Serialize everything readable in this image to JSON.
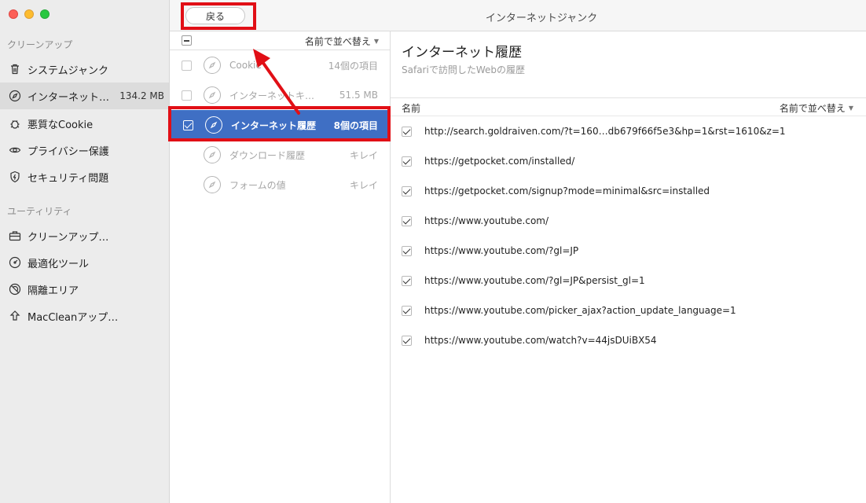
{
  "window": {
    "title": "インターネットジャンク"
  },
  "toolbar": {
    "back_label": "戻る"
  },
  "sidebar": {
    "sections": [
      {
        "title": "クリーンアップ"
      },
      {
        "title": "ユーティリティ"
      }
    ],
    "cleanup_items": [
      {
        "label": "システムジャンク",
        "icon": "trash-icon"
      },
      {
        "label": "インターネット…",
        "size": "134.2 MB",
        "icon": "compass-icon",
        "selected": true
      },
      {
        "label": "悪質なCookie",
        "icon": "bug-icon"
      },
      {
        "label": "プライバシー保護",
        "icon": "eye-icon"
      },
      {
        "label": "セキュリティ問題",
        "icon": "shield-icon"
      }
    ],
    "utility_items": [
      {
        "label": "クリーンアップ…",
        "icon": "briefcase-icon"
      },
      {
        "label": "最適化ツール",
        "icon": "gauge-icon"
      },
      {
        "label": "隔離エリア",
        "icon": "quarantine-icon"
      },
      {
        "label": "MacCleanアップ…",
        "icon": "upload-icon"
      }
    ]
  },
  "middle": {
    "sort_label": "名前で並べ替え",
    "rows": [
      {
        "label": "Cookie",
        "value": "14個の項目"
      },
      {
        "label": "インターネットキ…",
        "value": "51.5 MB"
      },
      {
        "label": "インターネット履歴",
        "value": "8個の項目",
        "active": true
      },
      {
        "label": "ダウンロード履歴",
        "value": "キレイ"
      },
      {
        "label": "フォームの値",
        "value": "キレイ"
      }
    ]
  },
  "detail": {
    "title": "インターネット履歴",
    "subtitle": "Safariで訪問したWebの履歴",
    "column_name": "名前",
    "sort_label": "名前で並べ替え",
    "urls": [
      "http://search.goldraiven.com/?t=160…db679f66f5e3&hp=1&rst=1610&z=1",
      "https://getpocket.com/installed/",
      "https://getpocket.com/signup?mode=minimal&src=installed",
      "https://www.youtube.com/",
      "https://www.youtube.com/?gl=JP",
      "https://www.youtube.com/?gl=JP&persist_gl=1",
      "https://www.youtube.com/picker_ajax?action_update_language=1",
      "https://www.youtube.com/watch?v=44jsDUiBX54"
    ]
  },
  "colors": {
    "accent": "#3f6fc4",
    "highlight_red": "#e10f16"
  }
}
